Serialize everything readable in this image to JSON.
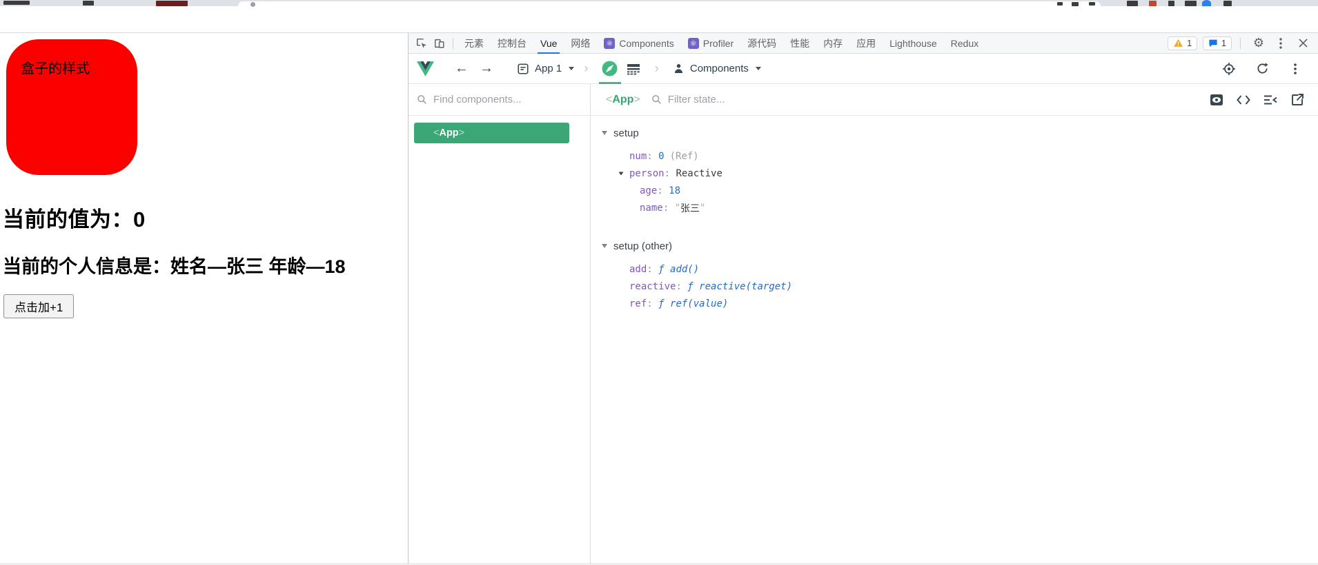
{
  "browser": {
    "icons": [
      "tab-favicon-fragment",
      "bookmark-icon-fragment",
      "omnibox-fragment",
      "extension-icon-fragment",
      "profile-avatar-fragment",
      "menu-icon-fragment"
    ]
  },
  "page": {
    "box_label": "盒子的样式",
    "box_color": "#fc0000",
    "value_line": "当前的值为：0",
    "info_line": "当前的个人信息是：姓名—张三 年龄—18",
    "button_label": "点击加+1"
  },
  "devtools": {
    "tabs": [
      {
        "label": "元素"
      },
      {
        "label": "控制台"
      },
      {
        "label": "Vue",
        "active": true
      },
      {
        "label": "网络"
      },
      {
        "label": "Components",
        "icon": "react-devtools-icon"
      },
      {
        "label": "Profiler",
        "icon": "react-devtools-icon"
      },
      {
        "label": "源代码"
      },
      {
        "label": "性能"
      },
      {
        "label": "内存"
      },
      {
        "label": "应用"
      },
      {
        "label": "Lighthouse"
      },
      {
        "label": "Redux"
      }
    ],
    "badges": {
      "warning_count": "1",
      "message_count": "1"
    },
    "toolbar": {
      "app_selector": "App 1",
      "inspector_selector": "Components",
      "icons": [
        "vue-logo",
        "back-arrow-icon",
        "forward-arrow-icon",
        "app-window-icon",
        "dropdown-caret-icon",
        "breadcrumb-chevron-icon",
        "inspector-compass-icon",
        "timeline-rows-icon",
        "components-person-icon",
        "pick-target-icon",
        "refresh-icon",
        "more-vertical-icon"
      ]
    },
    "components_panel": {
      "search_placeholder": "Find components...",
      "selected": {
        "open": "<",
        "name": "App",
        "close": ">"
      }
    },
    "state_panel": {
      "header_tag": {
        "open": "<",
        "name": "App",
        "close": ">"
      },
      "filter_placeholder": "Filter state...",
      "header_icons": [
        "inspect-dom-icon",
        "code-brackets-icon",
        "collapse-list-icon",
        "open-external-icon"
      ],
      "sections": [
        {
          "title": "setup",
          "items": [
            {
              "key": "num",
              "value": "0",
              "note": "(Ref)"
            },
            {
              "key": "person",
              "value": "Reactive"
            },
            {
              "key": "age",
              "value": "18"
            },
            {
              "key": "name",
              "value": "张三",
              "quote": "\""
            }
          ]
        },
        {
          "title": "setup (other)",
          "items": [
            {
              "key": "add",
              "value": "ƒ add()"
            },
            {
              "key": "reactive",
              "value": "ƒ reactive(target)"
            },
            {
              "key": "ref",
              "value": "ƒ ref(value)"
            }
          ]
        }
      ]
    },
    "colors": {
      "vue_green": "#42b983",
      "accent_blue": "#1a73e8",
      "key_purple": "#7e57c2",
      "value_blue": "#1f6bd1",
      "warning_orange": "#f5a623",
      "react_purple": "#6e61c8",
      "box_red": "#fc0000"
    }
  }
}
